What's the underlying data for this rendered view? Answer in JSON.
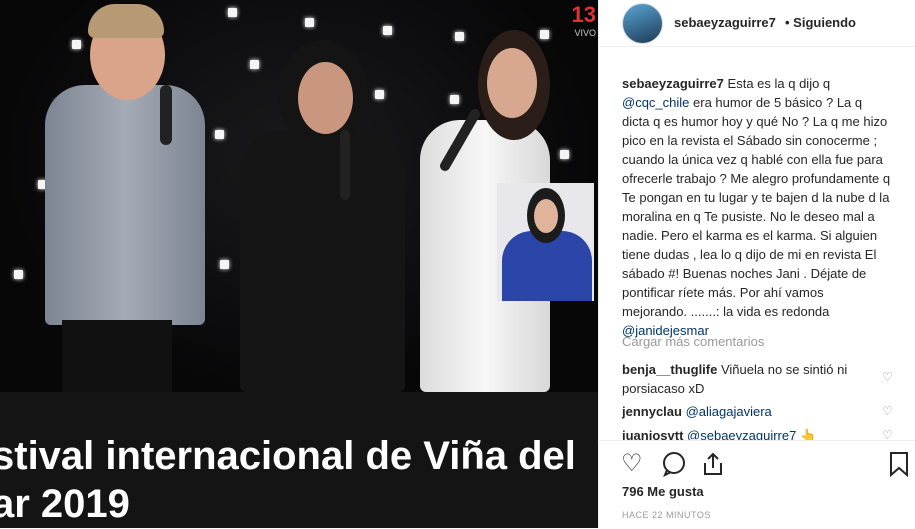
{
  "photo": {
    "channel": "13",
    "channel_sub": "VIVO",
    "banner_line1": "stival internacional de Viña del",
    "banner_line2": "ar 2019"
  },
  "post": {
    "username": "sebaeyzaguirre7",
    "follow_status": "• Siguiendo",
    "caption_user": "sebaeyzaguirre7",
    "caption_parts": [
      "Esta es la q dijo q ",
      "@cqc_chile",
      " era humor de 5 básico ? La q dicta q es humor hoy y qué No ? La q me hizo pico en la revista el Sábado sin conocerme ; cuando la única vez q hablé con ella fue para ofrecerle trabajo ? Me alegro profundamente q Te pongan en tu lugar y te bajen d la nube d la moralina en q Te pusiste. No le deseo mal a nadie. Pero el karma es el karma. Si alguien tiene dudas , lea lo q dijo de mi en revista El sábado #! Buenas noches Jani . Déjate de pontificar ríete más. Por ahí vamos mejorando. .......: la vida es redonda ",
      "@janidejesmar"
    ],
    "load_more": "Cargar más comentarios",
    "comments": [
      {
        "user": "benja__thuglife",
        "text": "Viñuela no se sintió ni porsiacaso xD"
      },
      {
        "user": "jennyclau",
        "text": "@aliagajaviera"
      },
      {
        "user": "juaniosvtt",
        "text": "@sebaeyzaguirre7 👆"
      }
    ],
    "likes": "796 Me gusta",
    "time": "HACE 22 MINUTOS",
    "icons": {
      "like": "heart-icon",
      "comment": "comment-icon",
      "share": "share-icon",
      "save": "bookmark-icon"
    }
  }
}
